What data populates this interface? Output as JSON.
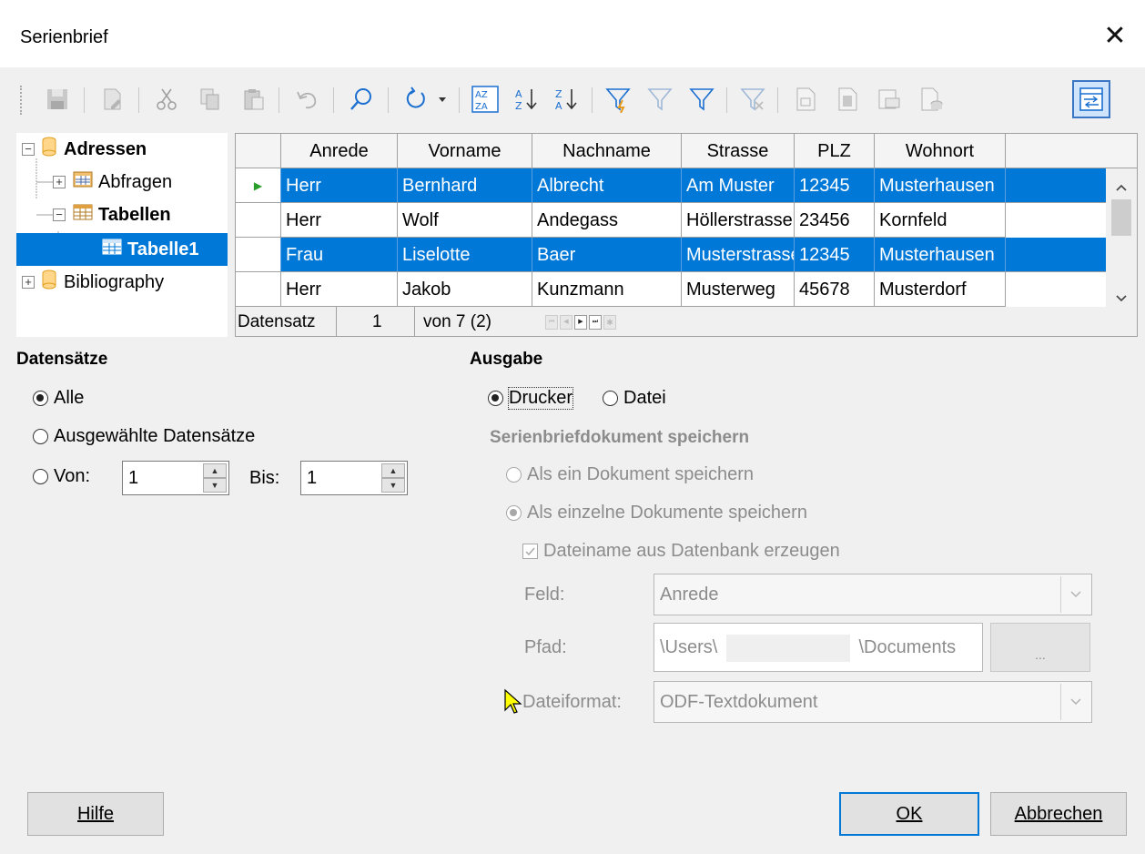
{
  "window": {
    "title": "Serienbrief",
    "close_glyph": "✕"
  },
  "toolbar": {
    "buttons": [
      "save-icon",
      "edit-icon",
      "cut-icon",
      "copy-icon",
      "paste-icon",
      "undo-icon",
      "find-icon",
      "refresh-icon",
      "sort-icon",
      "sort-ascending-icon",
      "sort-descending-icon",
      "autofilter-icon",
      "standard-filter-icon",
      "apply-filter-icon",
      "remove-filter-icon",
      "data-to-text-icon",
      "data-to-fields-icon",
      "mail-merge-icon",
      "data-source-icon",
      "explorer-toggle-icon"
    ],
    "selected": "explorer-toggle-icon"
  },
  "tree": {
    "items": [
      {
        "label": "Adressen",
        "bold": true
      },
      {
        "label": "Abfragen"
      },
      {
        "label": "Tabellen",
        "bold": true
      },
      {
        "label": "Tabelle1",
        "bold": true,
        "selected": true
      },
      {
        "label": "Bibliography"
      }
    ]
  },
  "grid": {
    "columns": [
      "Anrede",
      "Vorname",
      "Nachname",
      "Strasse",
      "PLZ",
      "Wohnort"
    ],
    "rows": [
      [
        "Herr",
        "Bernhard",
        "Albrecht",
        "Am Muster",
        "12345",
        "Musterhausen"
      ],
      [
        "Herr",
        "Wolf",
        "Andegass",
        "Höllerstrasse",
        "23456",
        "Kornfeld"
      ],
      [
        "Frau",
        "Liselotte",
        "Baer",
        "Musterstrasse",
        "12345",
        "Musterhausen"
      ],
      [
        "Herr",
        "Jakob",
        "Kunzmann",
        "Musterweg",
        "45678",
        "Musterdorf"
      ]
    ],
    "selected_rows": [
      0,
      2
    ],
    "current_row": 0,
    "nav": {
      "label": "Datensatz",
      "current": "1",
      "total": "von 7 (2)"
    }
  },
  "records": {
    "heading": "Datensätze",
    "all_label": "Alle",
    "selected_label": "Ausgewählte Datensätze",
    "from_label": "Von:",
    "from_value": "1",
    "to_label": "Bis:",
    "to_value": "1",
    "choice": "all"
  },
  "output": {
    "heading": "Ausgabe",
    "printer_label": "Drucker",
    "file_label": "Datei",
    "choice": "printer",
    "save_heading": "Serienbriefdokument speichern",
    "save_single_label": "Als ein Dokument speichern",
    "save_individual_label": "Als einzelne Dokumente speichern",
    "filename_from_db_label": "Dateiname aus Datenbank erzeugen",
    "field_label": "Feld:",
    "field_value": "Anrede",
    "path_label": "Pfad:",
    "path_prefix": "\\Users\\",
    "path_suffix": "\\Documents",
    "browse_label": "...",
    "format_label": "Dateiformat:",
    "format_value": "ODF-Textdokument"
  },
  "buttons": {
    "help": "Hilfe",
    "ok": "OK",
    "cancel": "Abbrechen"
  },
  "colors": {
    "selection": "#0078d7",
    "disabled_text": "#8c8c8c",
    "default_button_border": "#0078d7"
  }
}
